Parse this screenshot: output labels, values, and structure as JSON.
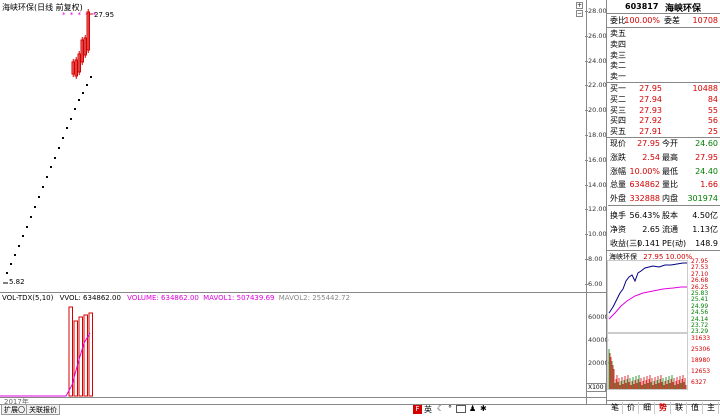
{
  "chart_title": "海峡环保(日线 前复权)",
  "price_labels": {
    "high": "27.95",
    "low": "5.82"
  },
  "y_axis_ticks": [
    "28.00",
    "26.00",
    "24.00",
    "22.00",
    "20.00",
    "18.00",
    "16.00",
    "14.00",
    "12.00",
    "10.00",
    "8.00",
    "6.00"
  ],
  "vol_header": {
    "name": "VOL-TDX(5,10)",
    "vvol": "VVOL: 634862.00",
    "volume": "VOLUME: 634862.00",
    "mavol1": "MAVOL1: 507439.69",
    "mavol2": "MAVOL2: 255442.72"
  },
  "vol_ticks": [
    "60000",
    "40000",
    "20000"
  ],
  "vol_unit": "X100",
  "year_label": "2017年",
  "stock": {
    "code": "603817",
    "name": "海峡环保"
  },
  "order_ratio": {
    "wb_label": "委比",
    "wb_value": "100.00%",
    "wc_label": "委差",
    "wc_value": "10708"
  },
  "asks": [
    {
      "label": "卖五",
      "price": "",
      "vol": ""
    },
    {
      "label": "卖四",
      "price": "",
      "vol": ""
    },
    {
      "label": "卖三",
      "price": "",
      "vol": ""
    },
    {
      "label": "卖二",
      "price": "",
      "vol": ""
    },
    {
      "label": "卖一",
      "price": "",
      "vol": ""
    }
  ],
  "bids": [
    {
      "label": "买一",
      "price": "27.95",
      "vol": "10488"
    },
    {
      "label": "买二",
      "price": "27.94",
      "vol": "84"
    },
    {
      "label": "买三",
      "price": "27.93",
      "vol": "55"
    },
    {
      "label": "买四",
      "price": "27.92",
      "vol": "56"
    },
    {
      "label": "买五",
      "price": "27.91",
      "vol": "25"
    }
  ],
  "quote": [
    {
      "l1": "现价",
      "v1": "27.95",
      "c1": "red",
      "l2": "今开",
      "v2": "24.60",
      "c2": "grn"
    },
    {
      "l1": "涨跌",
      "v1": "2.54",
      "c1": "red",
      "l2": "最高",
      "v2": "27.95",
      "c2": "red"
    },
    {
      "l1": "涨幅",
      "v1": "10.00%",
      "c1": "red",
      "l2": "最低",
      "v2": "24.40",
      "c2": "grn"
    },
    {
      "l1": "总量",
      "v1": "634862",
      "c1": "red",
      "l2": "量比",
      "v2": "1.66",
      "c2": "red"
    },
    {
      "l1": "外盘",
      "v1": "332888",
      "c1": "red",
      "l2": "内盘",
      "v2": "301974",
      "c2": "grn"
    },
    {
      "l1": "换手",
      "v1": "56.43%",
      "c1": "blk",
      "l2": "股本",
      "v2": "4.50亿",
      "c2": "blk"
    },
    {
      "l1": "净资",
      "v1": "2.65",
      "c1": "blk",
      "l2": "流通",
      "v2": "1.13亿",
      "c2": "blk"
    },
    {
      "l1": "收益(三)",
      "v1": "0.141",
      "c1": "blk",
      "l2": "PE(动)",
      "v2": "148.9",
      "c2": "blk"
    }
  ],
  "mini": {
    "title": "海峡环保",
    "price_change": "27.95 10.00%",
    "price_ticks": [
      "27.95",
      "27.53",
      "27.10",
      "26.68",
      "26.25",
      "25.83",
      "25.41",
      "24.99",
      "24.56",
      "24.14",
      "23.72",
      "23.29"
    ],
    "vol_ticks": [
      "31633",
      "25306",
      "18980",
      "12653",
      "6327"
    ]
  },
  "bottom_tabs": [
    "扩展〇",
    "关联报价"
  ],
  "toolbar_icons": [
    "F",
    "英"
  ],
  "right_tabs": [
    "笔",
    "价",
    "细",
    "势",
    "联",
    "值",
    "主"
  ],
  "colors": {
    "up": "#d40000",
    "down": "#008000",
    "volume_line": "#e000e0",
    "mini_price": "#000080"
  }
}
